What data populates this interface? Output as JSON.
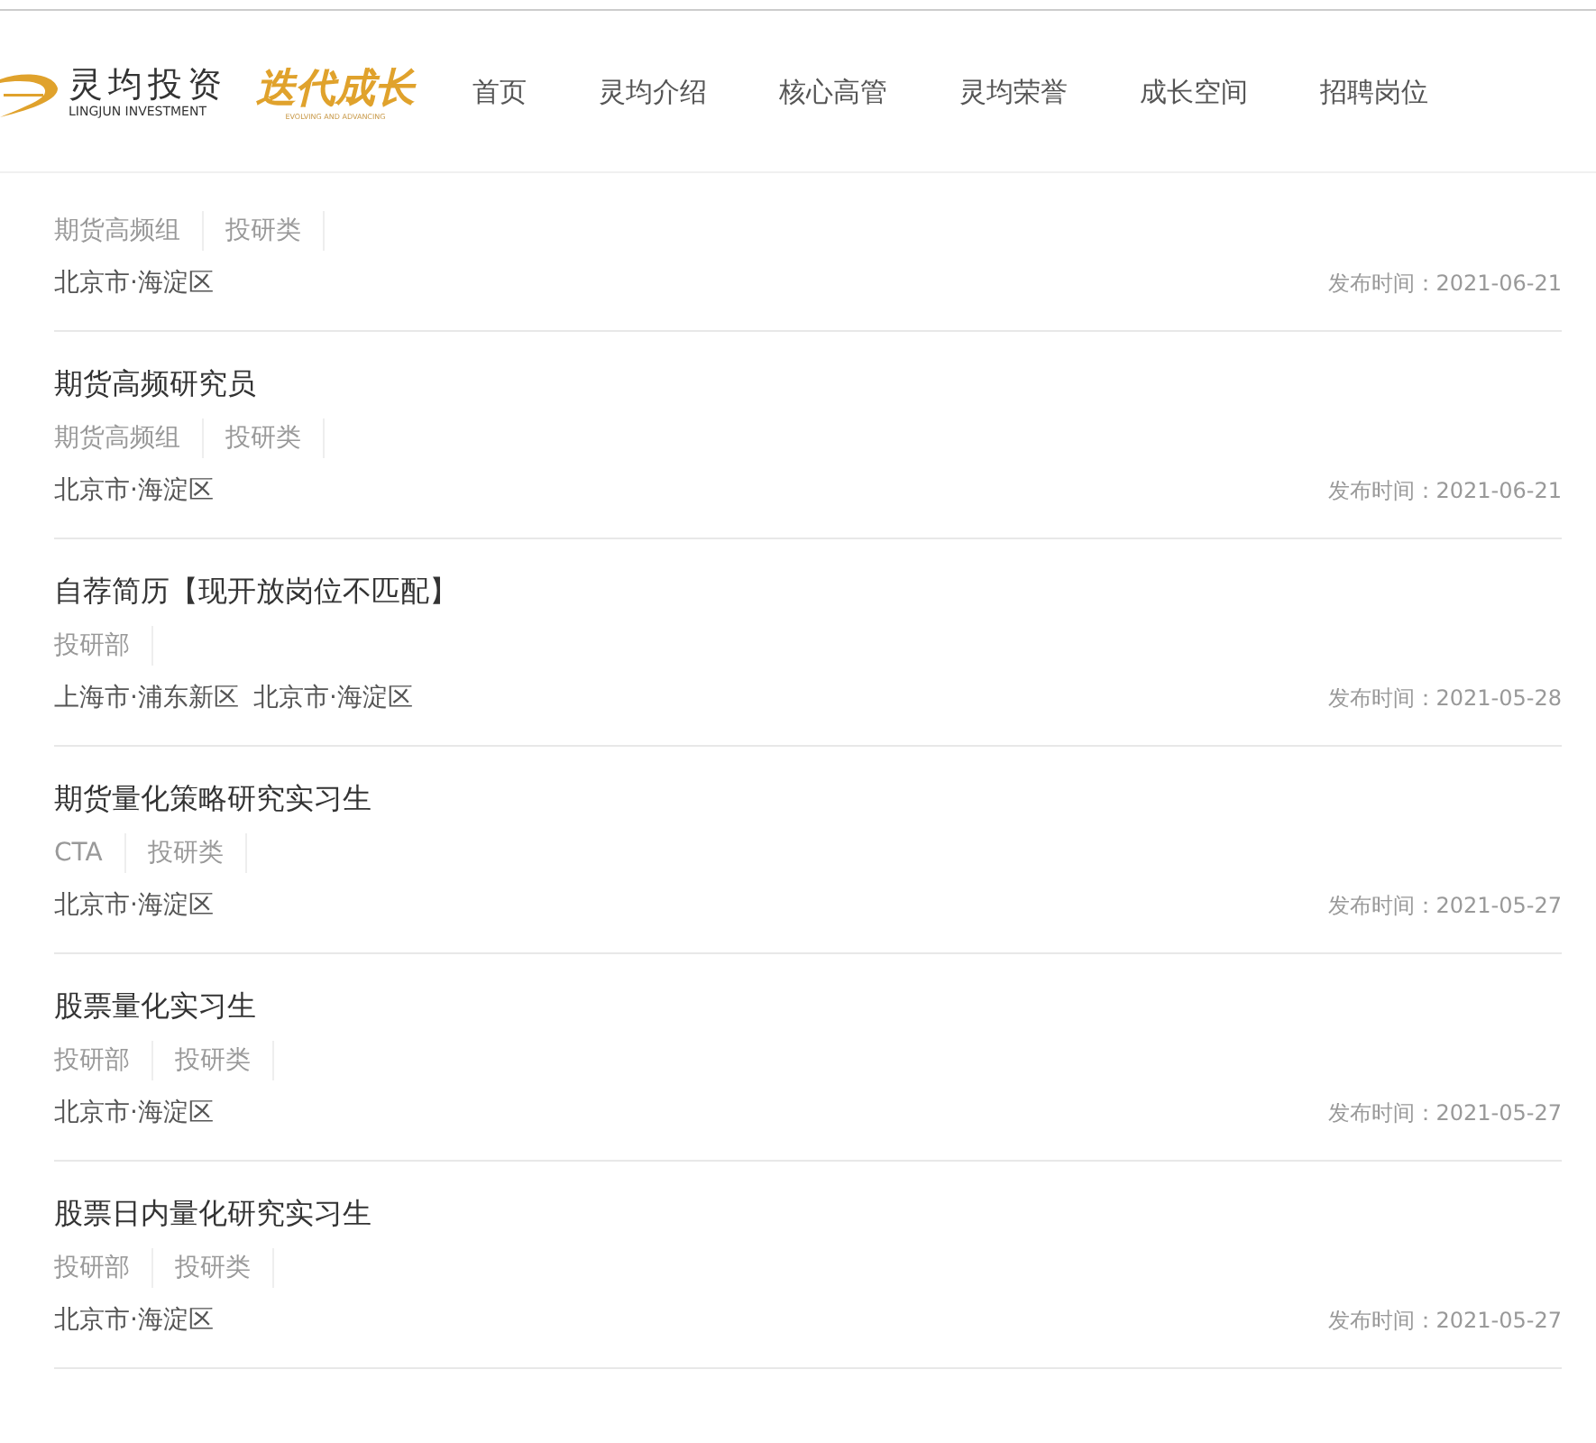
{
  "header": {
    "logo": {
      "name": "灵均投资",
      "subtitle": "LINGJUN INVESTMENT",
      "slogan": "迭代成长",
      "slogan_subtitle": "EVOLVING AND ADVANCING"
    },
    "nav": [
      {
        "label": "首页"
      },
      {
        "label": "灵均介绍"
      },
      {
        "label": "核心高管"
      },
      {
        "label": "灵均荣誉"
      },
      {
        "label": "成长空间"
      },
      {
        "label": "招聘岗位"
      }
    ]
  },
  "jobs": [
    {
      "tags": [
        "期货高频组",
        "投研类"
      ],
      "locations": [
        "北京市·海淀区"
      ],
      "date": "发布时间：2021-06-21"
    },
    {
      "title": "期货高频研究员",
      "tags": [
        "期货高频组",
        "投研类"
      ],
      "locations": [
        "北京市·海淀区"
      ],
      "date": "发布时间：2021-06-21"
    },
    {
      "title": "自荐简历【现开放岗位不匹配】",
      "tags": [
        "投研部"
      ],
      "locations": [
        "上海市·浦东新区",
        "北京市·海淀区"
      ],
      "date": "发布时间：2021-05-28"
    },
    {
      "title": "期货量化策略研究实习生",
      "tags": [
        "CTA",
        "投研类"
      ],
      "locations": [
        "北京市·海淀区"
      ],
      "date": "发布时间：2021-05-27"
    },
    {
      "title": "股票量化实习生",
      "tags": [
        "投研部",
        "投研类"
      ],
      "locations": [
        "北京市·海淀区"
      ],
      "date": "发布时间：2021-05-27"
    },
    {
      "title": "股票日内量化研究实习生",
      "tags": [
        "投研部",
        "投研类"
      ],
      "locations": [
        "北京市·海淀区"
      ],
      "date": "发布时间：2021-05-27"
    }
  ]
}
